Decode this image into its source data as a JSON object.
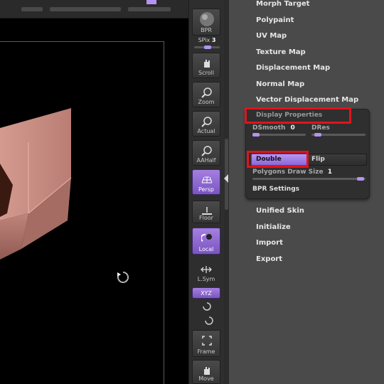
{
  "toolbar": {
    "bpr_label": "BPR",
    "spix_label": "SPix",
    "spix_value": "3",
    "scroll_label": "Scroll",
    "zoom_label": "Zoom",
    "actual_label": "Actual",
    "aahalf_label": "AAHalf",
    "persp_label": "Persp",
    "floor_label": "Floor",
    "local_label": "Local",
    "lsym_label": "L.Sym",
    "xyz_label": "XYZ",
    "frame_label": "Frame",
    "move_label": "Move"
  },
  "menu": {
    "items_top": [
      "Morph Target",
      "Polypaint",
      "UV Map",
      "Texture Map",
      "Displacement Map",
      "Normal Map",
      "Vector Displacement Map"
    ],
    "items_bottom": [
      "Unified Skin",
      "Initialize",
      "Import",
      "Export"
    ]
  },
  "display_properties": {
    "title": "Display Properties",
    "dsmooth_label": "DSmooth",
    "dsmooth_value": "0",
    "dres_label": "DRes",
    "double_label": "Double",
    "flip_label": "Flip",
    "polygons_draw_size_label": "Polygons Draw Size",
    "polygons_draw_size_value": "1",
    "bpr_settings_label": "BPR Settings"
  },
  "colors": {
    "accent": "#b493f2",
    "highlight": "#e0141c",
    "panel": "#4a4a4a"
  }
}
